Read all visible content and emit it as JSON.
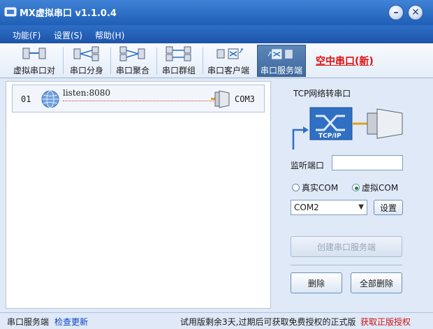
{
  "window": {
    "title": "MX虚拟串口  v1.1.0.4",
    "min_symbol": "–",
    "close_symbol": "✕"
  },
  "menu": {
    "items": [
      "功能(F)",
      "设置(S)",
      "帮助(H)"
    ]
  },
  "toolbar": {
    "items": [
      {
        "label": "虚拟串口对",
        "icon": "serial-pair-icon"
      },
      {
        "label": "串口分身",
        "icon": "serial-split-icon"
      },
      {
        "label": "串口聚合",
        "icon": "serial-aggregate-icon"
      },
      {
        "label": "串口群组",
        "icon": "serial-group-icon"
      },
      {
        "label": "串口客户端",
        "icon": "serial-client-icon"
      },
      {
        "label": "串口服务端",
        "icon": "serial-server-icon",
        "active": true
      }
    ],
    "promo": "空中串口(新)"
  },
  "list": {
    "rows": [
      {
        "index": "01",
        "listen": "listen:8080",
        "port": "COM3"
      }
    ]
  },
  "panel": {
    "title": "TCP网络转串口",
    "graphic_label": "TCP/IP",
    "port_label": "监听端口",
    "port_value": "",
    "radio_real": "真实COM",
    "radio_virtual": "虚拟COM",
    "radio_selected": "virtual",
    "com_select": "COM2",
    "settings_button": "设置",
    "create_button": "创建串口服务端",
    "delete_button": "删除",
    "delete_all_button": "全部删除"
  },
  "status": {
    "mode": "串口服务端",
    "update_link": "检查更新",
    "trial": "试用版剩余3天,过期后可获取免费授权的正式版",
    "buy_link": "获取正版授权"
  },
  "colors": {
    "title_bar": "#2f6fc4",
    "promo": "#e01010",
    "link": "#0b43c7",
    "buy_link": "#d01010"
  }
}
